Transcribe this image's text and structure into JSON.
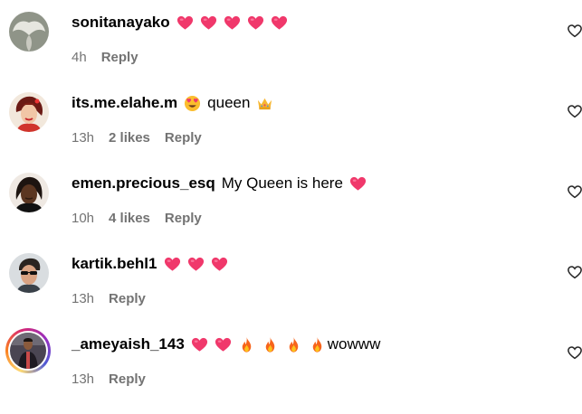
{
  "colors": {
    "text": "#000000",
    "secondary_text": "#737373",
    "heart_emoji": "#f0386b",
    "fire_emoji": "#f7641b"
  },
  "comments": [
    {
      "username": "sonitanayako",
      "text_before_emoji": "",
      "text_after_emoji": "",
      "emojis": [
        "heart-emoji",
        "heart-emoji",
        "heart-emoji",
        "heart-emoji",
        "heart-emoji"
      ],
      "time": "4h",
      "likes": "",
      "reply_label": "Reply",
      "avatar_icon": "angel-wings-avatar"
    },
    {
      "username": "its.me.elahe.m",
      "emojis": [
        "heart-eyes-emoji"
      ],
      "text": "queen",
      "trailing_emojis": [
        "crown-emoji"
      ],
      "time": "13h",
      "likes": "2 likes",
      "reply_label": "Reply",
      "avatar_icon": "pinup-woman-avatar"
    },
    {
      "username": "emen.precious_esq",
      "text": "My Queen is here",
      "trailing_emojis": [
        "heart-emoji"
      ],
      "time": "10h",
      "likes": "4 likes",
      "reply_label": "Reply",
      "avatar_icon": "woman-portrait-avatar"
    },
    {
      "username": "kartik.behl1",
      "emojis": [
        "heart-emoji",
        "heart-emoji",
        "heart-emoji"
      ],
      "time": "13h",
      "likes": "",
      "reply_label": "Reply",
      "avatar_icon": "man-sunglasses-avatar"
    },
    {
      "username": "_ameyaish_143",
      "emojis": [
        "heart-emoji",
        "heart-emoji",
        "fire-emoji",
        "fire-emoji",
        "fire-emoji",
        "fire-emoji"
      ],
      "text": "wowww",
      "time": "13h",
      "likes": "",
      "reply_label": "Reply",
      "avatar_icon": "man-standing-avatar"
    }
  ]
}
